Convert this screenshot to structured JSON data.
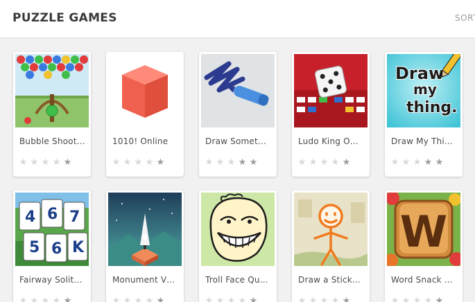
{
  "header": {
    "title": "PUZZLE GAMES",
    "sort_label": "SORT"
  },
  "rating_colors": {
    "empty": "#d8d8d8",
    "filled": "#9e9e9e"
  },
  "games": [
    {
      "title": "Bubble Shoot…",
      "stars_filled": 1,
      "icon": "bubble-shooter-thumbnail"
    },
    {
      "title": "1010! Online",
      "stars_filled": 1,
      "icon": "1010-cube-thumbnail"
    },
    {
      "title": "Draw Somet…",
      "stars_filled": 2,
      "icon": "draw-something-thumbnail"
    },
    {
      "title": "Ludo King O…",
      "stars_filled": 1,
      "icon": "ludo-king-thumbnail"
    },
    {
      "title": "Draw My Thi…",
      "stars_filled": 2,
      "icon": "draw-my-thing-thumbnail"
    },
    {
      "title": "Fairway Solit…",
      "stars_filled": 1,
      "icon": "fairway-solitaire-thumbnail"
    },
    {
      "title": "Monument V…",
      "stars_filled": 1,
      "icon": "monument-valley-thumbnail"
    },
    {
      "title": "Troll Face Qu…",
      "stars_filled": 1,
      "icon": "troll-face-thumbnail"
    },
    {
      "title": "Draw a Stick…",
      "stars_filled": 1,
      "icon": "draw-a-stickman-thumbnail"
    },
    {
      "title": "Word Snack …",
      "stars_filled": 1,
      "icon": "word-snack-thumbnail"
    }
  ],
  "thumbnail_text": {
    "draw_my_thing": [
      "Draw",
      "my",
      "thing."
    ],
    "fairway_cards": [
      "4",
      "6",
      "7",
      "5",
      "6",
      "K"
    ],
    "word_snack_letter": "W"
  }
}
